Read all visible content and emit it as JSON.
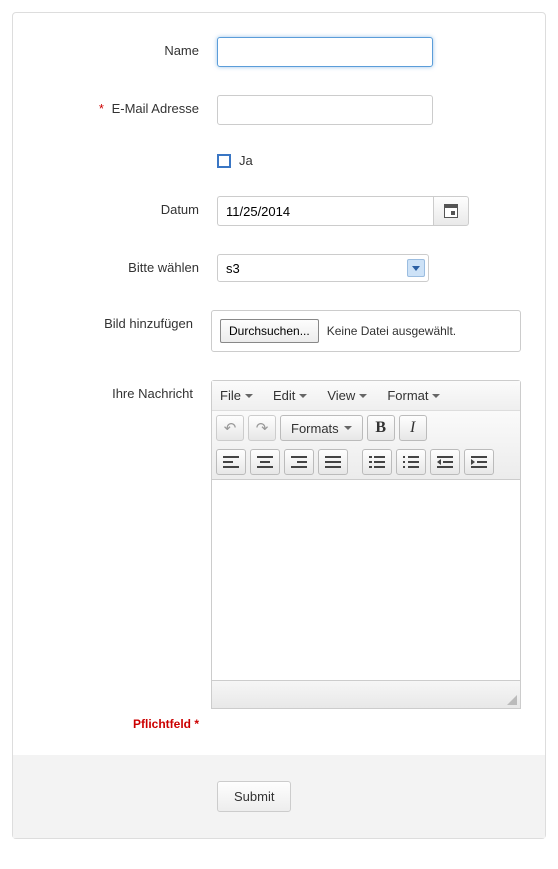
{
  "labels": {
    "name": "Name",
    "email": "E-Mail Adresse",
    "checkbox": "Ja",
    "date": "Datum",
    "select": "Bitte wählen",
    "file": "Bild hinzufügen",
    "message": "Ihre Nachricht",
    "required": "Pflichtfeld *"
  },
  "values": {
    "name": "",
    "email": "",
    "date": "11/25/2014",
    "select": "s3",
    "file_button": "Durchsuchen...",
    "file_status": "Keine Datei ausgewählt."
  },
  "editor": {
    "menu": {
      "file": "File",
      "edit": "Edit",
      "view": "View",
      "format": "Format"
    },
    "formats_btn": "Formats",
    "bold": "B",
    "italic": "I"
  },
  "submit": "Submit"
}
